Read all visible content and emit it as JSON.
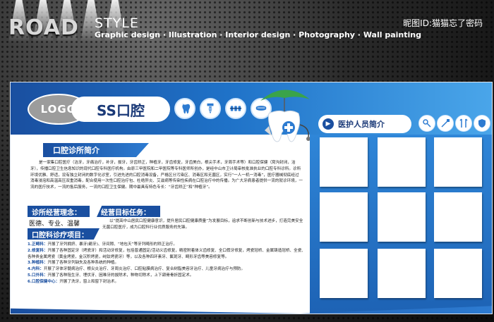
{
  "header": {
    "brand_road": "ROAD",
    "brand_style": "STYLE",
    "subline": "Graphic design · Illustration · Interior design · Photography · Wall painting",
    "nickname": "昵图ID:猫猫忘了密码"
  },
  "board": {
    "logo": "LOGO",
    "title": "SS口腔",
    "header_icons": [
      "tooth-icon",
      "implant-icon",
      "braces-icon",
      "dentures-icon"
    ],
    "intro": {
      "heading": "口腔诊所简介",
      "text": "是一家集口腔医疗（洁牙，牙痛治疗，补牙，拔牙，牙齿矫正，种植牙，牙齿修复，牙齿美白，根尖手术，牙周手术等）和口腔保健（窝沟封闭，洁牙），传播口腔卫生信息知识的现代口腔专科医疗机构。由原三甲医院和二甲医院等专科医师所创办，是经中山市卫计局审核批准执业的口腔专科诊所。诊所环境优雅、舒适，设有独立封闭的数字化诊室，引进先进的口腔消毒设备，严格区分污染区、消毒区和无菌区，实行“一人一机一消毒”，医疗器械彻底经过消毒浸泡和高温高压双重消毒，配合使用一次性口腔治疗包、杜绝肝炎、艾滋病等传染性疾病在口腔治疗中的传播。为广大牙病患者提供一流的就诊环境，一流的医疗技术，一流的售后服务，一流的口腔卫生保健。期中最具有特色专长：“牙齿矫正”和“种植牙”。"
    },
    "concept": {
      "heading": "诊所经营理念：",
      "text": "医德、专业、温馨"
    },
    "goal": {
      "heading": "经营目标任务：",
      "text": "以“提高中山居民口腔健康意识，提升居民口腔健康质量”为发展目标，追求不断创新与技术进步，打造完美安全无菌口腔医疗，成为口腔科行业优质服务的先锋。"
    },
    "projects": {
      "heading": "口腔科诊疗项目：",
      "items": [
        {
          "label": "1.正畸科：",
          "text": "开展了牙列拥挤、暴牙(龅牙)、牙间隙、“地包天”等牙列畸形的矫正治疗。"
        },
        {
          "label": "2.修复科：",
          "text": "开展了各种固定牙（烤瓷牙）和活动牙修复，包括普通固定/活动义齿修复，精密附着体义齿修复、全口假牙修复，烤瓷冠桥、金属铸造冠桥、全瓷、各种贵金属烤瓷（黄金烤瓷，金沉积烤瓷，纯钛烤瓷牙）等，以及各种四环素牙、氟斑牙、畸形牙齿等美容修复等。"
        },
        {
          "label": "3.种植科：",
          "text": "开展了各种牙列缺失及各种系统的种植。"
        },
        {
          "label": "4.内科：",
          "text": "开展了牙体牙髓病治疗、根尖炎治疗、牙周炎治疗、口腔粘膜病治疗、复合树脂美容牙治疗、儿童牙病治疗与预防。"
        },
        {
          "label": "5.口外科：",
          "text": "开展了各种阻生牙、埋伏牙、困难牙的拔除术，种物切除术，上下颌骨骨折固定术。"
        },
        {
          "label": "6.口腔保健中心：",
          "text": "开展了洗牙，窗上和窗下封治术。"
        }
      ]
    },
    "staff": {
      "heading": "医护人员简介",
      "icons": [
        "mouth-mirror-icon",
        "toothbrush-icon",
        "dental-tools-icon",
        "tooth-shield-icon"
      ],
      "photo_count": 9
    }
  }
}
